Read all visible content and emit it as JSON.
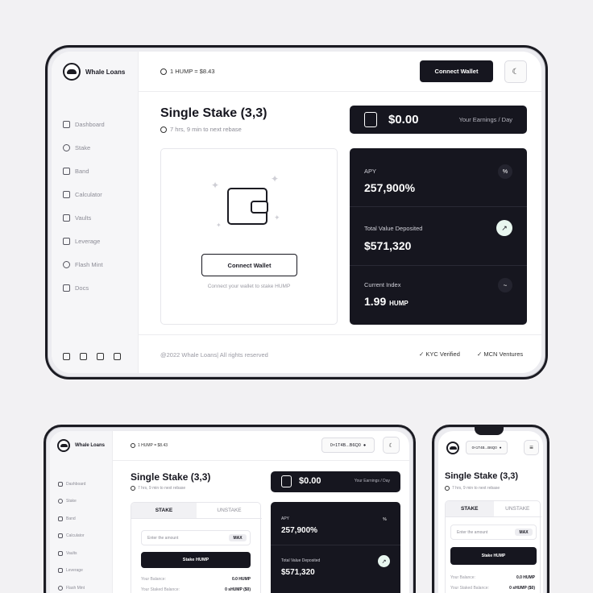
{
  "app": {
    "brand": "Whale Loans",
    "price": "1 HUMP = $8.43",
    "connect_wallet": "Connect Wallet",
    "theme_icon": "☾",
    "address": "0×1T4B...B6Q0"
  },
  "sidebar": {
    "items": [
      {
        "label": "Dashboard",
        "icon": "home-icon"
      },
      {
        "label": "Stake",
        "icon": "stake-icon"
      },
      {
        "label": "Band",
        "icon": "band-icon"
      },
      {
        "label": "Calculator",
        "icon": "calculator-icon"
      },
      {
        "label": "Vaults",
        "icon": "vault-icon"
      },
      {
        "label": "Leverage",
        "icon": "chart-icon"
      },
      {
        "label": "Flash Mint",
        "icon": "flash-icon"
      },
      {
        "label": "Docs",
        "icon": "doc-icon"
      }
    ],
    "social": [
      "discord-icon",
      "github-icon",
      "twitter-icon",
      "medium-icon"
    ]
  },
  "main": {
    "title": "Single Stake (3,3)",
    "rebase": "7 hrs, 9 min to next rebase",
    "earnings_amount": "$0.00",
    "earnings_label": "Your Earnings / Day",
    "connect_hint": "Connect your wallet to stake HUMP",
    "stats": [
      {
        "label": "APY",
        "value": "257,900%",
        "unit": "",
        "icon": "%"
      },
      {
        "label": "Total Value Deposited",
        "value": "$571,320",
        "unit": "",
        "icon": "↗"
      },
      {
        "label": "Current Index",
        "value": "1.99",
        "unit": "HUMP",
        "icon": "~"
      }
    ]
  },
  "footer": {
    "copyright": "@2022 Whale Loans| All rights reserved",
    "kyc": "KYC Verified",
    "mcn": "MCN Ventures"
  },
  "stake_form": {
    "tab_stake": "STAKE",
    "tab_unstake": "UNSTAKE",
    "placeholder": "Enter the amount",
    "max": "MAX",
    "stake_button": "Stake HUMP",
    "balance_label": "Your Balance:",
    "balance_value": "0.0 HUMP",
    "staked_label": "Your Staked Balance:",
    "staked_value": "0 sHUMP ($0)"
  }
}
